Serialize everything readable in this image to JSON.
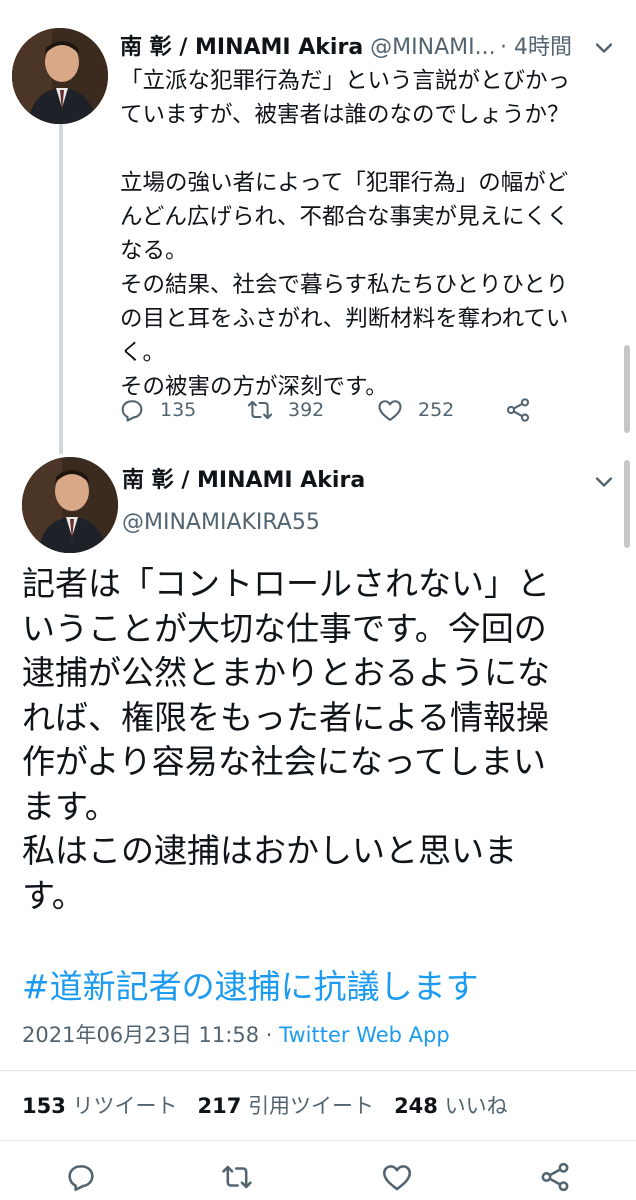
{
  "parent_tweet": {
    "display_name": "南 彰 / MINAMI Akira",
    "handle": "@MINAMI...",
    "time": "· 4時間",
    "body_lines": [
      "「立派な犯罪行為だ」という言説がとびかっ",
      "ていますが、被害者は誰のなのでしょうか？",
      "",
      "立場の強い者によって「犯罪行為」の幅がど",
      "んどん広げられ、不都合な事実が見えにくく",
      "なる。",
      "その結果、社会で暮らす私たちひとりひとり",
      "の目と耳をふさがれ、判断材料を奪われてい",
      "く。",
      "その被害の方が深刻です。"
    ],
    "reply_count": "135",
    "retweet_count": "392",
    "like_count": "252",
    "icons": [
      "more-icon",
      "reply-icon",
      "retweet-icon",
      "like-icon",
      "share-icon"
    ]
  },
  "main_tweet": {
    "display_name": "南 彰 / MINAMI Akira",
    "handle": "@MINAMIAKIRA55",
    "body_lines": [
      "記者は「コントロールされない」と",
      "いうことが大切な仕事です。今回の",
      "逮捕が公然とまかりとおるようにな",
      "れば、権限をもった者による情報操",
      "作がより容易な社会になってしまい",
      "ます。",
      "私はこの逮捕はおかしいと思いま",
      "す。"
    ],
    "hashtag": "#道新記者の逮捕に抗議します",
    "timestamp": "2021年06月23日 11:58 · ",
    "source": "Twitter Web App",
    "stats": {
      "retweets_num": "153",
      "retweets_label": "リツイート",
      "quotes_num": "217",
      "quotes_label": "引用ツイート",
      "likes_num": "248",
      "likes_label": "いいね"
    }
  },
  "colors": {
    "text": "#0f1419",
    "secondary": "#536471",
    "link": "#1d9bf0",
    "divider": "#e1e8ed"
  }
}
